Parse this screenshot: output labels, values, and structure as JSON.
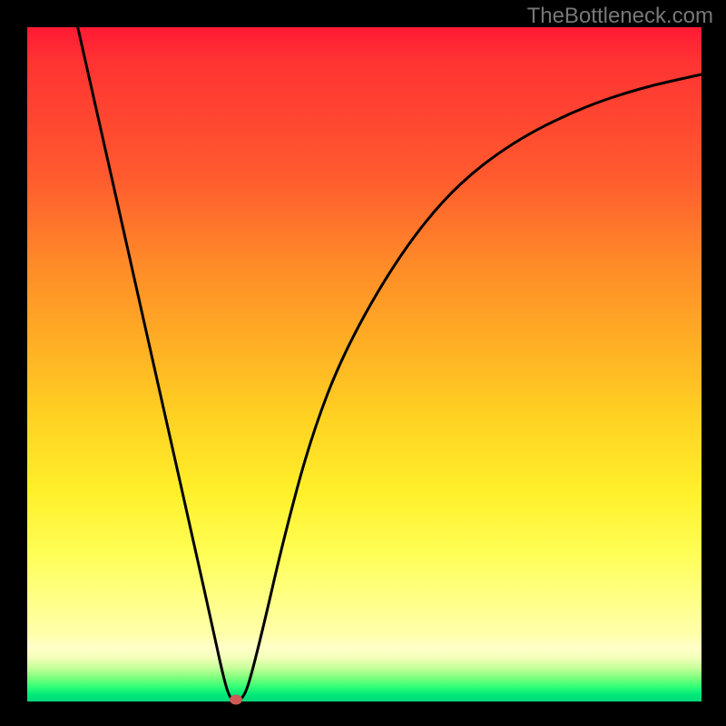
{
  "watermark": "TheBottleneck.com",
  "chart_data": {
    "type": "line",
    "title": "",
    "xlabel": "",
    "ylabel": "",
    "xlim": [
      0,
      1
    ],
    "ylim": [
      0,
      1
    ],
    "grid": false,
    "series": [
      {
        "name": "bottleneck-curve",
        "x": [
          0.075,
          0.1,
          0.15,
          0.2,
          0.25,
          0.275,
          0.29,
          0.3,
          0.31,
          0.32,
          0.33,
          0.35,
          0.38,
          0.42,
          0.47,
          0.55,
          0.63,
          0.72,
          0.82,
          0.91,
          1.0
        ],
        "values": [
          1.0,
          0.889,
          0.667,
          0.444,
          0.222,
          0.11,
          0.04,
          0.005,
          0.0,
          0.005,
          0.03,
          0.11,
          0.24,
          0.39,
          0.52,
          0.66,
          0.76,
          0.83,
          0.88,
          0.91,
          0.93
        ]
      }
    ],
    "minimum_marker": {
      "x": 0.31,
      "y": 0.0
    },
    "colors": {
      "curve": "#000000",
      "marker": "#cc5a55",
      "gradient_top": "#ff1a33",
      "gradient_bottom": "#00d878"
    }
  }
}
